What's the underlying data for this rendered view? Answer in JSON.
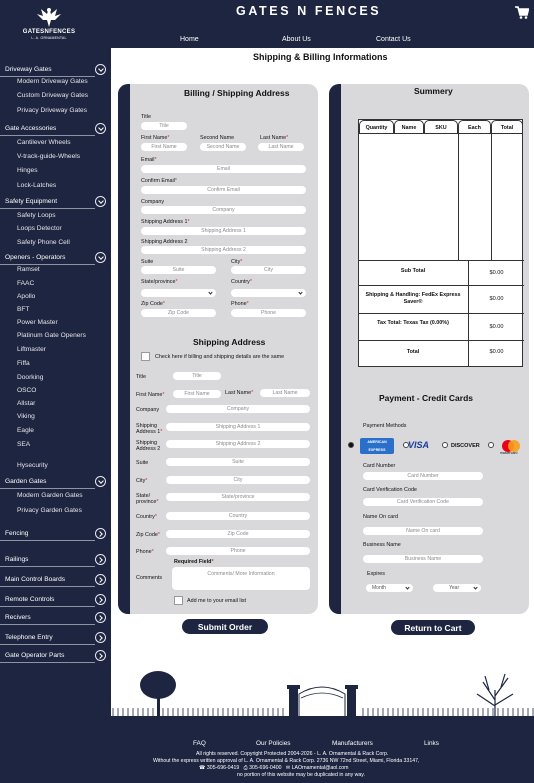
{
  "brand": {
    "site_title": "GATES N FENCES",
    "logo_name": "GATESNFENCES",
    "logo_sub": "L. A. ORNAMENTAL"
  },
  "nav": {
    "home": "Home",
    "about": "About Us",
    "contact": "Contact Us"
  },
  "page_title": "Shipping & Billing Informations",
  "sidebar": {
    "items": [
      {
        "label": "Driveway Gates",
        "arrow": "down"
      },
      {
        "label": "Modern Driveway Gates"
      },
      {
        "label": "Custom Driveway Gates"
      },
      {
        "label": "Privacy Driveway Gates"
      },
      {
        "label": "Gate Accessories",
        "arrow": "down"
      },
      {
        "label": "Cantilever Wheels"
      },
      {
        "label": "V-track-guide-Wheels"
      },
      {
        "label": "Hinges"
      },
      {
        "label": "Lock-Latches"
      },
      {
        "label": "Safety Equipment",
        "arrow": "down"
      },
      {
        "label": "Safety Loops"
      },
      {
        "label": "Loops Detector"
      },
      {
        "label": "Safety Phone Cell"
      },
      {
        "label": "Openers - Operators",
        "arrow": "down"
      },
      {
        "label": "Ramset"
      },
      {
        "label": "FAAC"
      },
      {
        "label": "Apollo"
      },
      {
        "label": "BFT"
      },
      {
        "label": "Power Master"
      },
      {
        "label": "Platinum Gate Openers"
      },
      {
        "label": "Liftmaster"
      },
      {
        "label": "Fiffa"
      },
      {
        "label": "Doorking"
      },
      {
        "label": "OSCO"
      },
      {
        "label": "Allstar"
      },
      {
        "label": "Viking"
      },
      {
        "label": "Eagle"
      },
      {
        "label": "SEA"
      },
      {
        "label": "Hysecurity"
      },
      {
        "label": "Garden Gates",
        "arrow": "down"
      },
      {
        "label": "Modern Garden Gates"
      },
      {
        "label": "Privacy Garden Gates"
      },
      {
        "label": "Fencing",
        "arrow": "right"
      },
      {
        "label": "Railings",
        "arrow": "right"
      },
      {
        "label": "Main Control Boards",
        "arrow": "right"
      },
      {
        "label": "Remote Controls",
        "arrow": "right"
      },
      {
        "label": "Recivers",
        "arrow": "right"
      },
      {
        "label": "Telephone Entry",
        "arrow": "right"
      },
      {
        "label": "Gate Operator Parts",
        "arrow": "right"
      }
    ]
  },
  "billing": {
    "title": "Billing / Shipping Address",
    "title_label": "Title",
    "title_placeholder": "Title",
    "first_name_label": "First Name",
    "first_name_placeholder": "First Name",
    "second_name_label": "Second Name",
    "second_name_placeholder": "Second Name",
    "last_name_label": "Last Name",
    "last_name_placeholder": "Last Name",
    "email_label": "Email",
    "email_placeholder": "Email",
    "confirm_email_label": "Confirm Email",
    "confirm_email_placeholder": "Confirm Email",
    "company_label": "Company",
    "company_placeholder": "Company",
    "address1_label": "Shipping Address 1",
    "address1_placeholder": "Shipping Address 1",
    "address2_label": "Shipping Address 2",
    "address2_placeholder": "Shipping Address 2",
    "suite_label": "Suite",
    "suite_placeholder": "Suite",
    "city_label": "City",
    "city_placeholder": "City",
    "state_label": "State/province",
    "country_label": "Country",
    "zip_label": "Zip Code",
    "zip_placeholder": "Zip Code",
    "phone_label": "Phone",
    "phone_placeholder": "Phone"
  },
  "shipping": {
    "title": "Shipping Address",
    "same_check_label": "Check here if billing and shipping details are the same",
    "title_label": "Title",
    "title_placeholder": "Title",
    "first_name_label": "First Name",
    "first_name_placeholder": "First Name",
    "last_name_label": "Last Name",
    "last_name_placeholder": "Last Name",
    "company_label": "Company",
    "company_placeholder": "Company",
    "address1_label": "Shipping Address 1",
    "address1_placeholder": "Shipping Address 1",
    "address2_label": "Shipping Address 2",
    "address2_placeholder": "Shipping Address 2",
    "suite_label": "Suite",
    "suite_placeholder": "Suite",
    "city_label": "City",
    "city_placeholder": "City",
    "state_label": "State/ province",
    "state_placeholder": "State/province",
    "country_label": "Country",
    "country_placeholder": "Country",
    "zip_label": "Zip Code",
    "zip_placeholder": "Zip Code",
    "phone_label": "Phone",
    "phone_placeholder": "Phone",
    "required_field": "Required Field",
    "comments_label": "Comments",
    "comments_placeholder": "Comments/ More Information",
    "mailing_list_label": "Add me to your email list"
  },
  "summary": {
    "title": "Summery",
    "columns": [
      "Quantity",
      "Name",
      "SKU",
      "Each",
      "Total"
    ],
    "rows": [
      {
        "label": "Sub Total",
        "value": "$0.00"
      },
      {
        "label": "Shipping & Handling: FedEx Express Saver®",
        "value": "$0.00"
      },
      {
        "label": "Tax Total: Texas Tax (0.00%)",
        "value": "$0.00"
      },
      {
        "label": "Total",
        "value": "$0.00"
      }
    ]
  },
  "payment": {
    "title": "Payment - Credit Cards",
    "methods_label": "Payment Methods",
    "card_logos": [
      "AMERICAN EXPRESS",
      "VISA",
      "DISCOVER",
      "mastercard"
    ],
    "card_number_label": "Card Number",
    "card_number_placeholder": "Card Number",
    "cvc_label": "Card Verification Code",
    "cvc_placeholder": "Card Verification Code",
    "name_label": "Name On card",
    "name_placeholder": "Name On card",
    "business_label": "Business Name",
    "business_placeholder": "Business Name",
    "expires_label": "Expires",
    "month_value": "Month",
    "year_value": "Year"
  },
  "buttons": {
    "submit": "Submit  Order",
    "return": "Return to Cart"
  },
  "footer": {
    "links": [
      "FAQ",
      "Our Policies",
      "Manufacturers",
      "Links"
    ],
    "copyright": "All rights reserved. Copyright Protected 2004-2026 - L. A. Ornamental & Rack Corp.",
    "notice": "Without the express written approval of L. A. Ornamental & Rack Corp. 2736 NW 72nd Street, Miami, Florida 33147,",
    "phone1": "305-696-0419",
    "phone2": "305-696-0400",
    "email": "LAOrnamental@aol.com",
    "no_portion": "no portion of this website may be duplicated in any way."
  },
  "colors": {
    "navy": "#1e2540",
    "panel": "#d9d9db",
    "required": "#c0392b"
  }
}
